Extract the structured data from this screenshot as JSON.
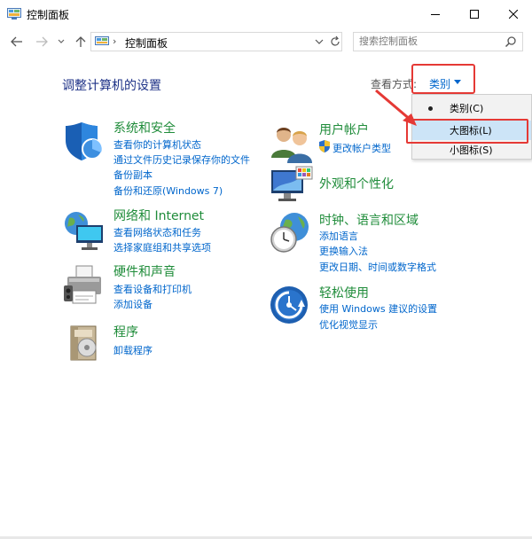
{
  "window": {
    "title": "控制面板"
  },
  "address": {
    "separator": "›",
    "path": "控制面板",
    "search_placeholder": "搜索控制面板"
  },
  "header": {
    "title": "调整计算机的设置",
    "view_by_label": "查看方式:",
    "view_by_value": "类别"
  },
  "view_menu": {
    "items": [
      {
        "label": "类别(C)",
        "selected": true
      },
      {
        "label": "大图标(L)",
        "highlighted": true
      },
      {
        "label": "小图标(S)"
      }
    ]
  },
  "categories": {
    "system": {
      "title": "系统和安全",
      "links": [
        "查看你的计算机状态",
        "通过文件历史记录保存你的文件",
        "备份副本",
        "备份和还原(Windows 7)"
      ]
    },
    "network": {
      "title": "网络和 Internet",
      "links": [
        "查看网络状态和任务",
        "选择家庭组和共享选项"
      ]
    },
    "hardware": {
      "title": "硬件和声音",
      "links": [
        "查看设备和打印机",
        "添加设备"
      ]
    },
    "programs": {
      "title": "程序",
      "links": [
        "卸载程序"
      ]
    },
    "user": {
      "title": "用户帐户",
      "links": [
        "更改帐户类型"
      ]
    },
    "appearance": {
      "title": "外观和个性化"
    },
    "clock": {
      "title": "时钟、语言和区域",
      "links": [
        "添加语言",
        "更换输入法",
        "更改日期、时间或数字格式"
      ]
    },
    "ease": {
      "title": "轻松使用",
      "links": [
        "使用 Windows 建议的设置",
        "优化视觉显示"
      ]
    }
  },
  "colors": {
    "category_title": "#1f8c3a",
    "link": "#0066cc",
    "highlight_red": "#e53935",
    "menu_selected_bg": "#cce4f7"
  },
  "icons": {
    "system": "shield-icon",
    "network": "globe-monitor-icon",
    "hardware": "printer-icon",
    "programs": "program-box-icon",
    "user": "users-icon",
    "appearance": "monitor-paint-icon",
    "clock": "clock-globe-icon",
    "ease": "ease-of-access-icon"
  }
}
